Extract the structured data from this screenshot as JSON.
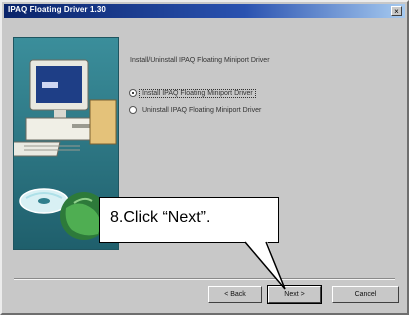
{
  "window": {
    "title": "IPAQ Floating Driver 1.30",
    "close_glyph": "×"
  },
  "instruction": "Install/Uninstall IPAQ Floating Miniport Driver",
  "options": [
    {
      "label": "Install IPAQ Floating Miniport Driver",
      "checked": true
    },
    {
      "label": "Uninstall IPAQ Floating Miniport Driver",
      "checked": false
    }
  ],
  "buttons": {
    "back": "< Back",
    "next": "Next >",
    "cancel": "Cancel"
  },
  "callout": {
    "text": "8.Click “Next”."
  },
  "icons": [
    "computer-icon",
    "cd-disc-icon",
    "globe-icon"
  ],
  "colors": {
    "title_bar": "#0a246a",
    "illustration_bg": "#2f7f8d",
    "dialog_bg": "#c8c8c8"
  }
}
